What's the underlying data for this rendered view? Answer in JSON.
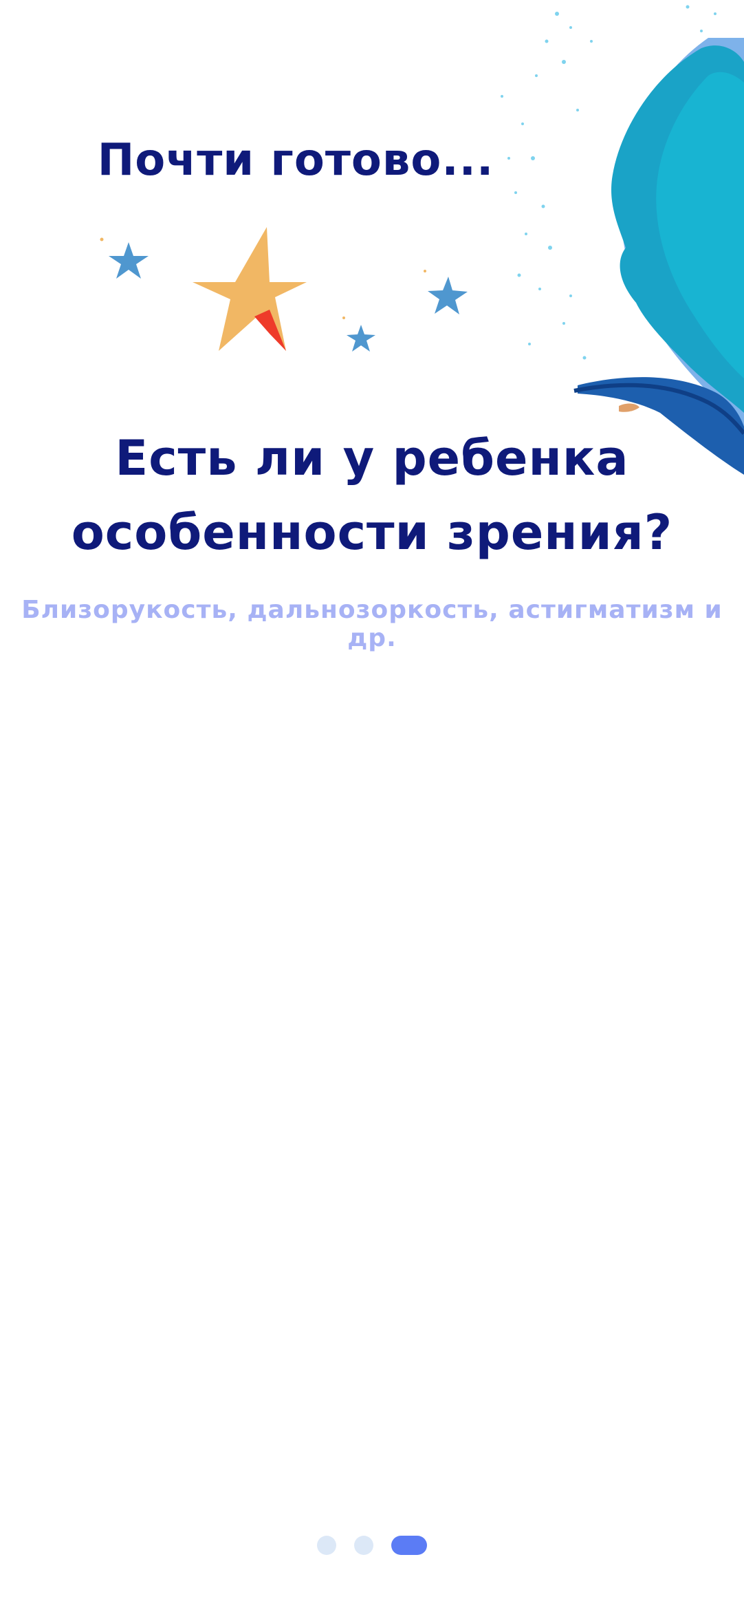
{
  "onboarding": {
    "kicker": "Почти готово...",
    "question_line1": "Есть ли у ребенка",
    "question_line2": "особенности зрения?",
    "hint": "Близорукость, дальнозоркость, астигматизм и др."
  },
  "pager": {
    "total_pages": 3,
    "current_page": 3
  },
  "illustrations": {
    "feather": "feather-illustration",
    "stars": "stars-illustration"
  },
  "colors": {
    "background": "#ffffff",
    "heading": "#0f1a7a",
    "hint": "#a7b2f5",
    "dot_inactive": "#dce8f7",
    "dot_active": "#5b7cf5",
    "star_gold": "#f1b764",
    "star_blue": "#4f97cf",
    "feather_teal": "#1aa3c7",
    "feather_blue": "#1d5fae"
  }
}
